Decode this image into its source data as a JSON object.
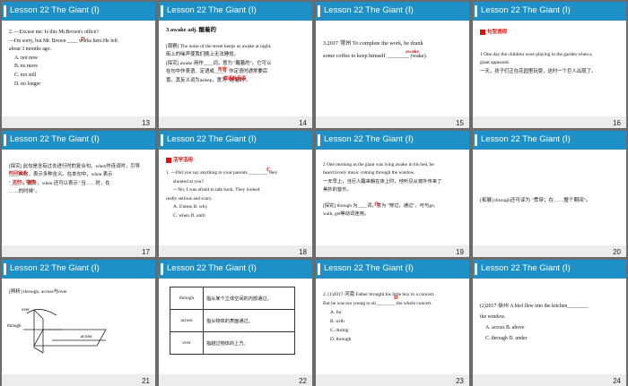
{
  "slides": [
    {
      "header": "Lesson 22  The Giant (Ⅰ)",
      "page": "13",
      "lines": [
        "2. —Excuse me. Is this Mr.Brown's office?",
        "—I'm sorry, but Mr. Brown ____ works here.He left",
        "about 3 months ago.",
        "A.  not now",
        "B.  no more",
        "C.  not still",
        "D.  no longer"
      ],
      "answer": "D"
    },
    {
      "header": "Lesson 22  The Giant (Ⅰ)",
      "page": "14",
      "word": "3   awake  adj. 醒着的",
      "lines": [
        "[观察] The noise of the street keeps us awake at night.",
        "街上的噪声使我们晚上无法睡觉。",
        "[探究] awake 用作____词，意为 \"醒着的\"。它可以",
        "在句中作表语、定语或____，作定语时通常要后",
        "置。其反义词为asleep，意为 \"睡着的\"。"
      ],
      "fills": [
        "形容",
        "宾语补足语"
      ]
    },
    {
      "header": "Lesson 22  The Giant (Ⅰ)",
      "page": "15",
      "lines": [
        "3.2017·常州   To complete the work, he drank",
        "some coffee to keep himself ________ (wake)."
      ],
      "answer": "awake"
    },
    {
      "header": "Lesson 22  The Giant (Ⅰ)",
      "page": "16",
      "tag": "句型透视",
      "lines": [
        "1   One day the children were playing in the garden when a",
        "giant appeared.",
        "一天，孩子们正在花园里玩耍，这时一个巨人出现了。"
      ]
    },
    {
      "header": "Lesson 22  The Giant (Ⅰ)",
      "page": "17",
      "lines": [
        "[探究] 此句是含有过去进行时的复合句。when作连词时，引导",
        "____从句，表示多种含义。在本句中，when 表示",
        "\"____\"，此外，when 还可以表示 \"当……时，在",
        "……的时候\"。"
      ],
      "fills": [
        "时间状语",
        "这时，突然"
      ]
    },
    {
      "header": "Lesson 22  The Giant (Ⅰ)",
      "page": "18",
      "tag": "活学活用",
      "lines": [
        "1.  —Did you say anything to your parents ________ they",
        "shouted at you?",
        "—No, I was afraid to talk back. They looked",
        "really serious and scary.",
        "A.  Unless  B.  why",
        "C.  when  D.  until"
      ],
      "answer": "C"
    },
    {
      "header": "Lesson 22  The Giant (Ⅰ)",
      "page": "19",
      "lines": [
        "2   One morning as the giant was lying awake in his bed, he",
        "heard lovely music coming through the window.",
        "一天早上，当巨人醒来躺在床上时，他听见从窗外传来了",
        "美妙的音乐。",
        "[探究] through 为____词，意为 \"穿过，通过\"，可与go,",
        "walk, get等动词连用。"
      ],
      "fills": [
        "介"
      ]
    },
    {
      "header": "Lesson 22  The Giant (Ⅰ)",
      "page": "20",
      "lines": [
        "[拓展] through还可译为 \"贯穿；在……整个期间\"。"
      ]
    },
    {
      "header": "Lesson 22  The Giant (Ⅰ)",
      "page": "21",
      "lines": [
        "[辨析] through, across与over"
      ],
      "labels": [
        "over",
        "through",
        "across"
      ]
    },
    {
      "header": "Lesson 22  The Giant (Ⅰ)",
      "page": "22",
      "table": [
        {
          "k": "through",
          "v": "指从某个立体空间的内部通过。"
        },
        {
          "k": "across",
          "v": "指从物体的表面通过。"
        },
        {
          "k": "over",
          "v": "指越过物体的上方。"
        }
      ]
    },
    {
      "header": "Lesson 22  The Giant (Ⅰ)",
      "page": "23",
      "lines": [
        "2.  (1)2017·河南   Father brought his little boy to a concert.",
        "But he was  too young to sit________ the whole concert.",
        "A.  for",
        "B.  with",
        "C.  during",
        "D.  through"
      ],
      "answer": "D"
    },
    {
      "header": "Lesson 22  The Giant (Ⅰ)",
      "page": "24",
      "lines": [
        "(2)2017·徐州   A bird flew into the kitchen________",
        "the window.",
        "A.  across    B.  above",
        "C.  through  D.  under"
      ]
    }
  ]
}
